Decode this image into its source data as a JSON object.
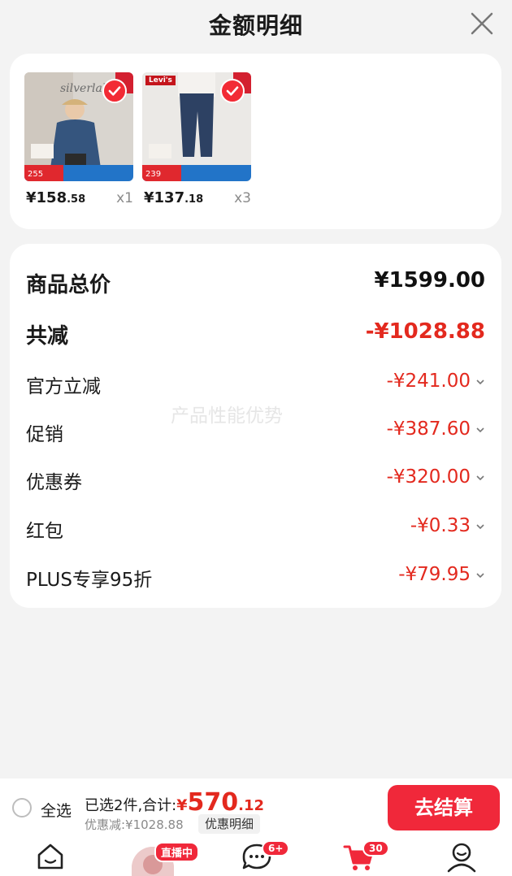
{
  "header": {
    "title": "金额明细"
  },
  "products": [
    {
      "brand": "silverlab",
      "price_main": "¥158",
      "price_decimal": ".58",
      "qty": "x1",
      "tag_price": "255"
    },
    {
      "brand": "Levi's",
      "price_main": "¥137",
      "price_decimal": ".18",
      "qty": "x3",
      "tag_price": "239"
    }
  ],
  "summary": {
    "total_label": "商品总价",
    "total_value": "¥1599.00",
    "reduce_label": "共减",
    "reduce_value": "-¥1028.88",
    "items": [
      {
        "label": "官方立减",
        "value": "-¥241.00"
      },
      {
        "label": "促销",
        "value": "-¥387.60"
      },
      {
        "label": "优惠券",
        "value": "-¥320.00"
      },
      {
        "label": "红包",
        "value": "-¥0.33"
      },
      {
        "label": "PLUS专享95折",
        "value": "-¥79.95"
      }
    ]
  },
  "watermark": "产品性能优势",
  "footer": {
    "select_all": "全选",
    "selected_text": "已选2件,合计:",
    "total_symbol": "¥",
    "total_int": "570",
    "total_dec": ".12",
    "discount_text": "优惠减:¥1028.88",
    "detail_button": "优惠明细",
    "checkout_button": "去结算"
  },
  "tabbar": {
    "live_badge": "直播中",
    "message_badge": "6+",
    "cart_badge": "30"
  },
  "colors": {
    "accent": "#f0283a",
    "discount": "#e3291e"
  }
}
